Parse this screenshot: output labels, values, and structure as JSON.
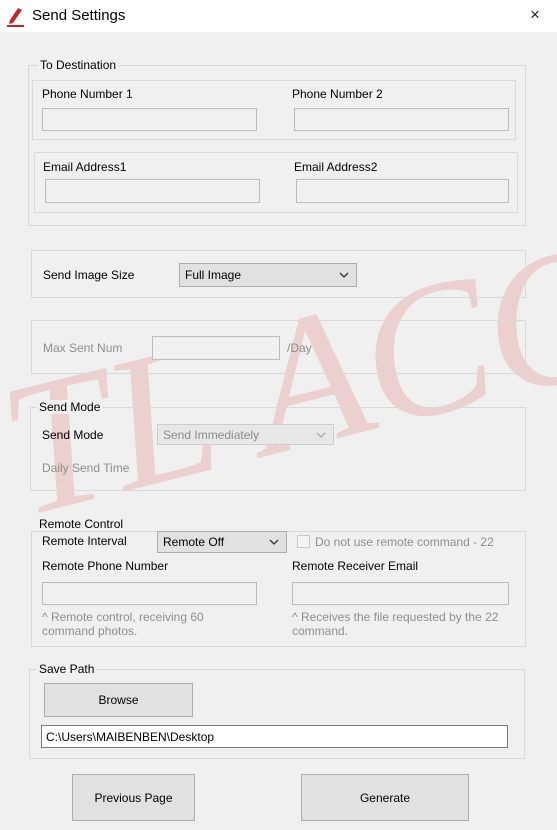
{
  "window": {
    "title": "Send Settings",
    "close_glyph": "×",
    "app_icon": "red-pen-icon"
  },
  "watermark": {
    "text": "TL ACORN",
    "color": "#e9b4b4"
  },
  "destination": {
    "legend": "To Destination",
    "phone1_label": "Phone Number 1",
    "phone1_value": "",
    "phone2_label": "Phone Number 2",
    "phone2_value": "",
    "email1_label": "Email Address1",
    "email1_value": "",
    "email2_label": "Email Address2",
    "email2_value": ""
  },
  "image_size": {
    "label": "Send Image Size",
    "selected": "Full Image"
  },
  "max_sent": {
    "label": "Max Sent Num",
    "value": "",
    "unit": "/Day"
  },
  "send_mode": {
    "legend": "Send Mode",
    "label": "Send Mode",
    "selected": "Send Immediately",
    "daily_time_label": "Daily Send Time"
  },
  "remote": {
    "legend": "Remote Control",
    "interval_label": "Remote Interval",
    "interval_selected": "Remote Off",
    "checkbox_label": "Do not use remote command - 22",
    "checkbox_checked": false,
    "phone_label": "Remote Phone Number",
    "phone_value": "",
    "email_label": "Remote Receiver Email",
    "email_value": "",
    "phone_hint": "^ Remote control, receiving 60 command photos.",
    "email_hint": "^ Receives the file requested by the 22 command."
  },
  "save_path": {
    "legend": "Save Path",
    "browse_label": "Browse",
    "path_value": "C:\\Users\\MAIBENBEN\\Desktop"
  },
  "footer": {
    "previous_label": "Previous Page",
    "generate_label": "Generate"
  },
  "colors": {
    "window_bg": "#f0f0f0",
    "group_border": "#d9d9d9",
    "disabled_text": "#8e8e8e",
    "icon_red": "#c0282d"
  }
}
